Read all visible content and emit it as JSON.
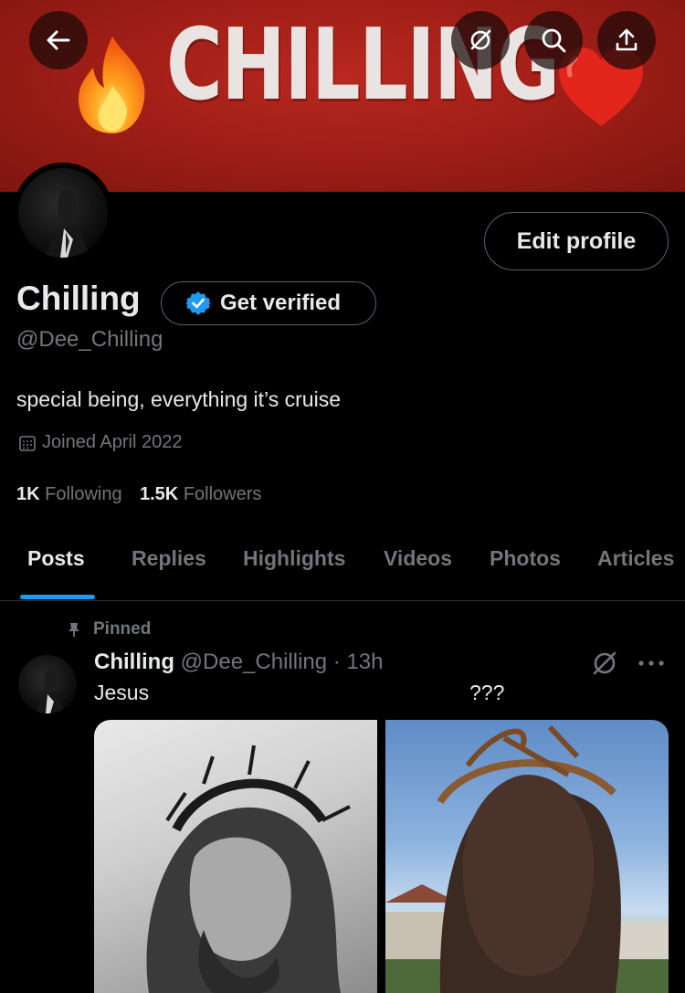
{
  "banner": {
    "title": "CHILLING",
    "bg_color": "#a3211a"
  },
  "header_buttons": {
    "back": "back-arrow-icon",
    "grok": "grok-icon",
    "search": "search-icon",
    "share": "share-icon"
  },
  "profile": {
    "name": "Chilling",
    "handle": "@Dee_Chilling",
    "bio": "special being, everything it’s cruise",
    "joined": "Joined April 2022",
    "edit_label": "Edit profile",
    "verify_label": "Get verified",
    "following_count": "1K",
    "following_label": "Following",
    "followers_count": "1.5K",
    "followers_label": "Followers"
  },
  "tabs": [
    {
      "label": "Posts",
      "active": true
    },
    {
      "label": "Replies",
      "active": false
    },
    {
      "label": "Highlights",
      "active": false
    },
    {
      "label": "Videos",
      "active": false
    },
    {
      "label": "Photos",
      "active": false
    },
    {
      "label": "Articles",
      "active": false
    }
  ],
  "post": {
    "pinned_label": "Pinned",
    "author_name": "Chilling",
    "author_handle": "@Dee_Chilling",
    "separator": "·",
    "time": "13h",
    "text_left": "Jesus",
    "text_right": "???"
  },
  "colors": {
    "accent": "#1d9bf0",
    "muted": "#71767b",
    "border": "#536471"
  }
}
